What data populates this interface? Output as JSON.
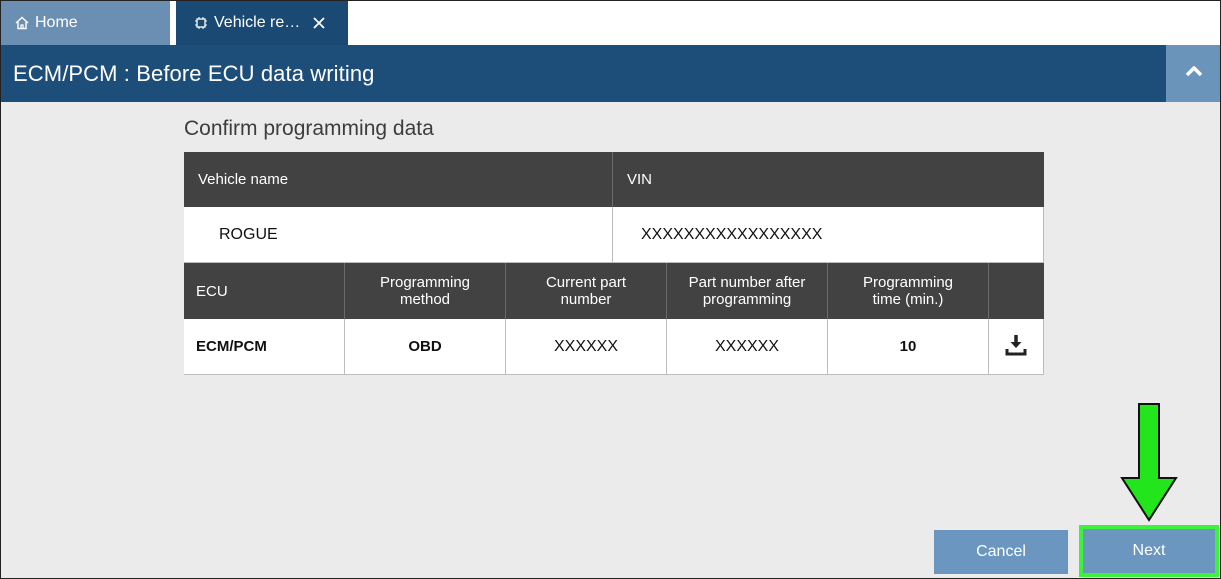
{
  "tabs": {
    "home_label": "Home",
    "vehicle_label": "Vehicle re…"
  },
  "header": {
    "title": "ECM/PCM : Before ECU data writing"
  },
  "section": {
    "title": "Confirm programming data"
  },
  "vehicle_table": {
    "vehicle_name_header": "Vehicle name",
    "vin_header": "VIN",
    "vehicle_name": "ROGUE",
    "vin": "XXXXXXXXXXXXXXXXX"
  },
  "ecu_table": {
    "headers": {
      "ecu": "ECU",
      "method": "Programming method",
      "current_part": "Current part number",
      "part_after": "Part number after programming",
      "time": "Programming time (min.)"
    },
    "row": {
      "ecu": "ECM/PCM",
      "method": "OBD",
      "current_part": "XXXXXX",
      "part_after": "XXXXXX",
      "time": "10"
    }
  },
  "buttons": {
    "cancel": "Cancel",
    "next": "Next"
  },
  "colors": {
    "accent_dark": "#1d4e79",
    "button": "#6b96c0",
    "highlight": "#3cf23c"
  },
  "icons": [
    "home-icon",
    "chip-icon",
    "close-icon",
    "chevron-up-icon",
    "download-icon",
    "arrow-down-icon"
  ]
}
